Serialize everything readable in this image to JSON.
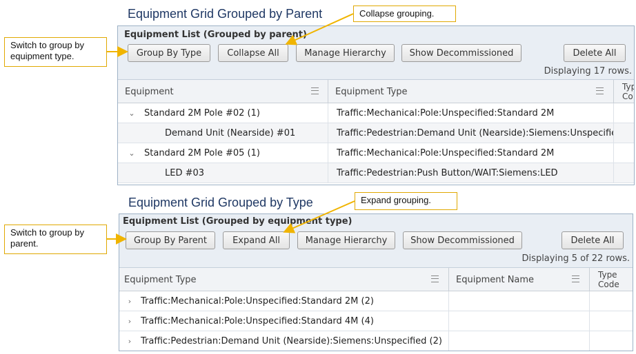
{
  "top": {
    "section_title": "Equipment Grid Grouped by Parent",
    "grid_title": "Equipment List (Grouped by parent)",
    "buttons": {
      "group_by": "Group By Type",
      "collapse_all": "Collapse All",
      "manage_hierarchy": "Manage Hierarchy",
      "show_decommissioned": "Show Decommissioned",
      "delete_all": "Delete All"
    },
    "row_count": "Displaying 17 rows.",
    "columns": [
      "Equipment",
      "Equipment Type",
      "Type Code"
    ],
    "type_code_lines": [
      "Typ",
      "Co"
    ],
    "rows": [
      {
        "group": true,
        "equipment": "Standard 2M Pole #02  (1)",
        "type": "Traffic:Mechanical:Pole:Unspecified:Standard 2M"
      },
      {
        "group": false,
        "equipment": "Demand Unit (Nearside) #01",
        "type": "Traffic:Pedestrian:Demand Unit (Nearside):Siemens:Unspecified"
      },
      {
        "group": true,
        "equipment": "Standard 2M Pole #05  (1)",
        "type": "Traffic:Mechanical:Pole:Unspecified:Standard 2M"
      },
      {
        "group": false,
        "equipment": "LED #03",
        "type": "Traffic:Pedestrian:Push Button/WAIT:Siemens:LED"
      }
    ],
    "callouts": {
      "collapse": "Collapse grouping.",
      "switch": "Switch to group by equipment type."
    }
  },
  "bottom": {
    "section_title": "Equipment Grid Grouped by Type",
    "grid_title": "Equipment List (Grouped by equipment type)",
    "buttons": {
      "group_by": "Group By Parent",
      "expand_all": "Expand All",
      "manage_hierarchy": "Manage Hierarchy",
      "show_decommissioned": "Show Decommissioned",
      "delete_all": "Delete All"
    },
    "row_count": "Displaying 5 of 22 rows.",
    "columns": [
      "Equipment Type",
      "Equipment Name",
      "Type Code"
    ],
    "type_code_lines": [
      "Type",
      "Code"
    ],
    "rows": [
      {
        "group": true,
        "type": "Traffic:Mechanical:Pole:Unspecified:Standard 2M  (2)"
      },
      {
        "group": true,
        "type": "Traffic:Mechanical:Pole:Unspecified:Standard 4M  (4)"
      },
      {
        "group": true,
        "type": "Traffic:Pedestrian:Demand Unit (Nearside):Siemens:Unspecified  (2)"
      }
    ],
    "callouts": {
      "expand": "Expand grouping.",
      "switch": "Switch to group by parent."
    }
  },
  "colors": {
    "title": "#1f3864",
    "callout_border": "#e0a800",
    "arrow": "#f0b400",
    "panel_bg": "#e9eef4"
  },
  "icons": {
    "expanded": "chevron-down-icon",
    "collapsed": "chevron-right-icon",
    "column_menu": "column-menu-icon"
  }
}
